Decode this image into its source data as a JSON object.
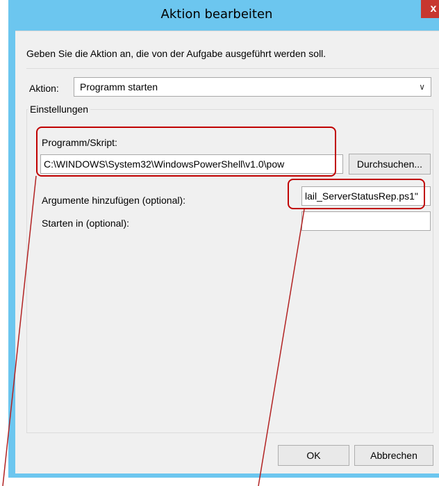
{
  "window": {
    "title": "Aktion bearbeiten",
    "close_label": "x"
  },
  "instruction_text": "Geben Sie die Aktion an, die von der Aufgabe ausgeführt werden soll.",
  "action": {
    "label": "Aktion:",
    "selected": "Programm starten",
    "dropdown_icon": "chevron-down"
  },
  "settings": {
    "group_label": "Einstellungen",
    "program_label": "Programm/Skript:",
    "program_value": "C:\\WINDOWS\\System32\\WindowsPowerShell\\v1.0\\pow",
    "browse_label": "Durchsuchen...",
    "arguments_label": "Argumente hinzufügen (optional):",
    "arguments_value": "lail_ServerStatusRep.ps1\"",
    "start_in_label": "Starten in (optional):",
    "start_in_value": ""
  },
  "buttons": {
    "ok": "OK",
    "cancel": "Abbrechen"
  },
  "colors": {
    "titlebar": "#6cc6ef",
    "close_button": "#c7372f",
    "highlight": "#c00000",
    "annotation_line": "#b22222"
  }
}
